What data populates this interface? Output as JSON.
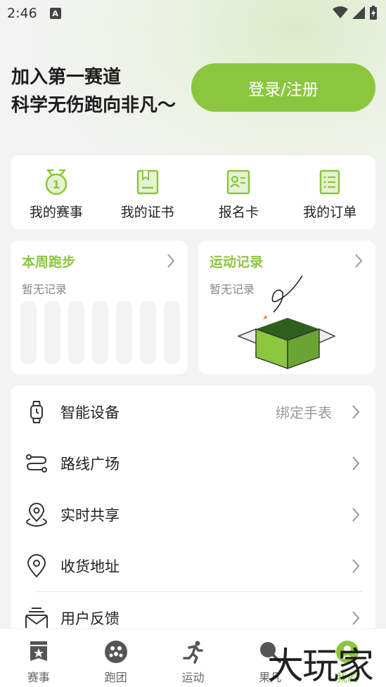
{
  "status": {
    "time": "2:46",
    "badge": "A"
  },
  "hero": {
    "line1": "加入第一赛道",
    "line2": "科学无伤跑向非凡～",
    "login_label": "登录/注册"
  },
  "quick": [
    {
      "label": "我的赛事",
      "icon": "medal-icon"
    },
    {
      "label": "我的证书",
      "icon": "certificate-icon"
    },
    {
      "label": "报名卡",
      "icon": "id-card-icon"
    },
    {
      "label": "我的订单",
      "icon": "order-list-icon"
    }
  ],
  "week_card": {
    "title": "本周跑步",
    "empty": "暂无记录",
    "bar_count": 7
  },
  "record_card": {
    "title": "运动记录",
    "empty": "暂无记录"
  },
  "menu": [
    {
      "label": "智能设备",
      "value": "绑定手表",
      "icon": "watch-icon"
    },
    {
      "label": "路线广场",
      "value": "",
      "icon": "route-icon"
    },
    {
      "label": "实时共享",
      "value": "",
      "icon": "location-share-icon"
    },
    {
      "label": "收货地址",
      "value": "",
      "icon": "address-pin-icon"
    },
    {
      "label": "用户反馈",
      "value": "",
      "icon": "mail-icon"
    }
  ],
  "tabs": [
    {
      "label": "赛事",
      "icon": "event-badge-icon",
      "active": false
    },
    {
      "label": "跑团",
      "icon": "group-icon",
      "active": false
    },
    {
      "label": "运动",
      "icon": "runner-icon",
      "active": false
    },
    {
      "label": "果凡",
      "icon": "search-icon",
      "active": false
    },
    {
      "label": "我的",
      "icon": "profile-icon",
      "active": true
    }
  ],
  "watermark": "大玩家",
  "colors": {
    "accent": "#8cc63f",
    "box": "#6aa533"
  }
}
